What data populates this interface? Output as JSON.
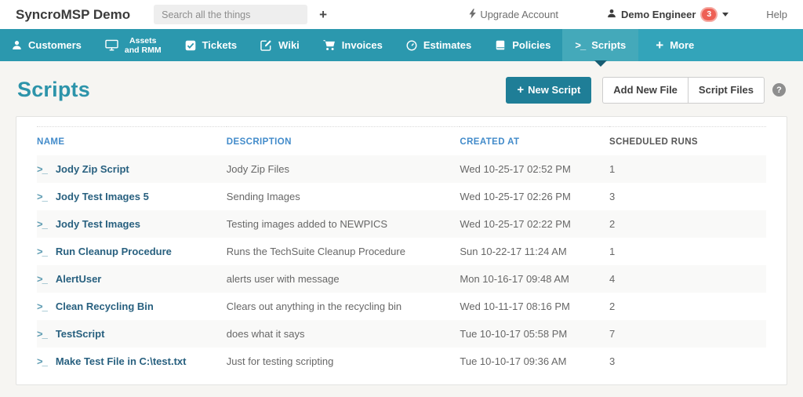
{
  "topbar": {
    "brand": "SyncroMSP Demo",
    "search_placeholder": "Search all the things",
    "new_item_plus": "+",
    "upgrade_label": "Upgrade Account",
    "user_name": "Demo Engineer",
    "notification_count": "3",
    "help_label": "Help"
  },
  "nav": {
    "items": [
      {
        "label": "Customers"
      },
      {
        "line1": "Assets",
        "line2": "and RMM"
      },
      {
        "label": "Tickets"
      },
      {
        "label": "Wiki"
      },
      {
        "label": "Invoices"
      },
      {
        "label": "Estimates"
      },
      {
        "label": "Policies"
      },
      {
        "label": "Scripts",
        "active": true
      },
      {
        "label": "More"
      }
    ]
  },
  "page": {
    "title": "Scripts",
    "new_script_label": "New Script",
    "add_new_file_label": "Add New File",
    "script_files_label": "Script Files"
  },
  "icons": {
    "terminal_glyph": ">_",
    "plus_glyph": "+",
    "help_glyph": "?"
  },
  "table": {
    "columns": [
      "NAME",
      "DESCRIPTION",
      "CREATED AT",
      "SCHEDULED RUNS"
    ],
    "rows": [
      {
        "name": "Jody Zip Script",
        "description": "Jody Zip Files",
        "created_at": "Wed 10-25-17 02:52 PM",
        "scheduled_runs": "1"
      },
      {
        "name": "Jody Test Images 5",
        "description": "Sending Images",
        "created_at": "Wed 10-25-17 02:26 PM",
        "scheduled_runs": "3"
      },
      {
        "name": "Jody Test Images",
        "description": "Testing images added to NEWPICS",
        "created_at": "Wed 10-25-17 02:22 PM",
        "scheduled_runs": "2"
      },
      {
        "name": "Run Cleanup Procedure",
        "description": "Runs the TechSuite Cleanup Procedure",
        "created_at": "Sun 10-22-17 11:24 AM",
        "scheduled_runs": "1"
      },
      {
        "name": "AlertUser",
        "description": "alerts user with message",
        "created_at": "Mon 10-16-17 09:48 AM",
        "scheduled_runs": "4"
      },
      {
        "name": "Clean Recycling Bin",
        "description": "Clears out anything in the recycling bin",
        "created_at": "Wed 10-11-17 08:16 PM",
        "scheduled_runs": "2"
      },
      {
        "name": "TestScript",
        "description": "does what it says",
        "created_at": "Tue 10-10-17 05:58 PM",
        "scheduled_runs": "7"
      },
      {
        "name": "Make Test File in C:\\test.txt",
        "description": "Just for testing scripting",
        "created_at": "Tue 10-10-17 09:36 AM",
        "scheduled_runs": "3"
      }
    ]
  },
  "colors": {
    "nav_teal": "#2b98ae",
    "nav_active_tab": "#44a9ba",
    "nav_more_section": "#33a4ba",
    "accent_button": "#1f7e97",
    "column_link_blue": "#428bca",
    "script_name_link": "#28607f",
    "badge_red": "#ee6055",
    "title_teal": "#2d94aa"
  }
}
